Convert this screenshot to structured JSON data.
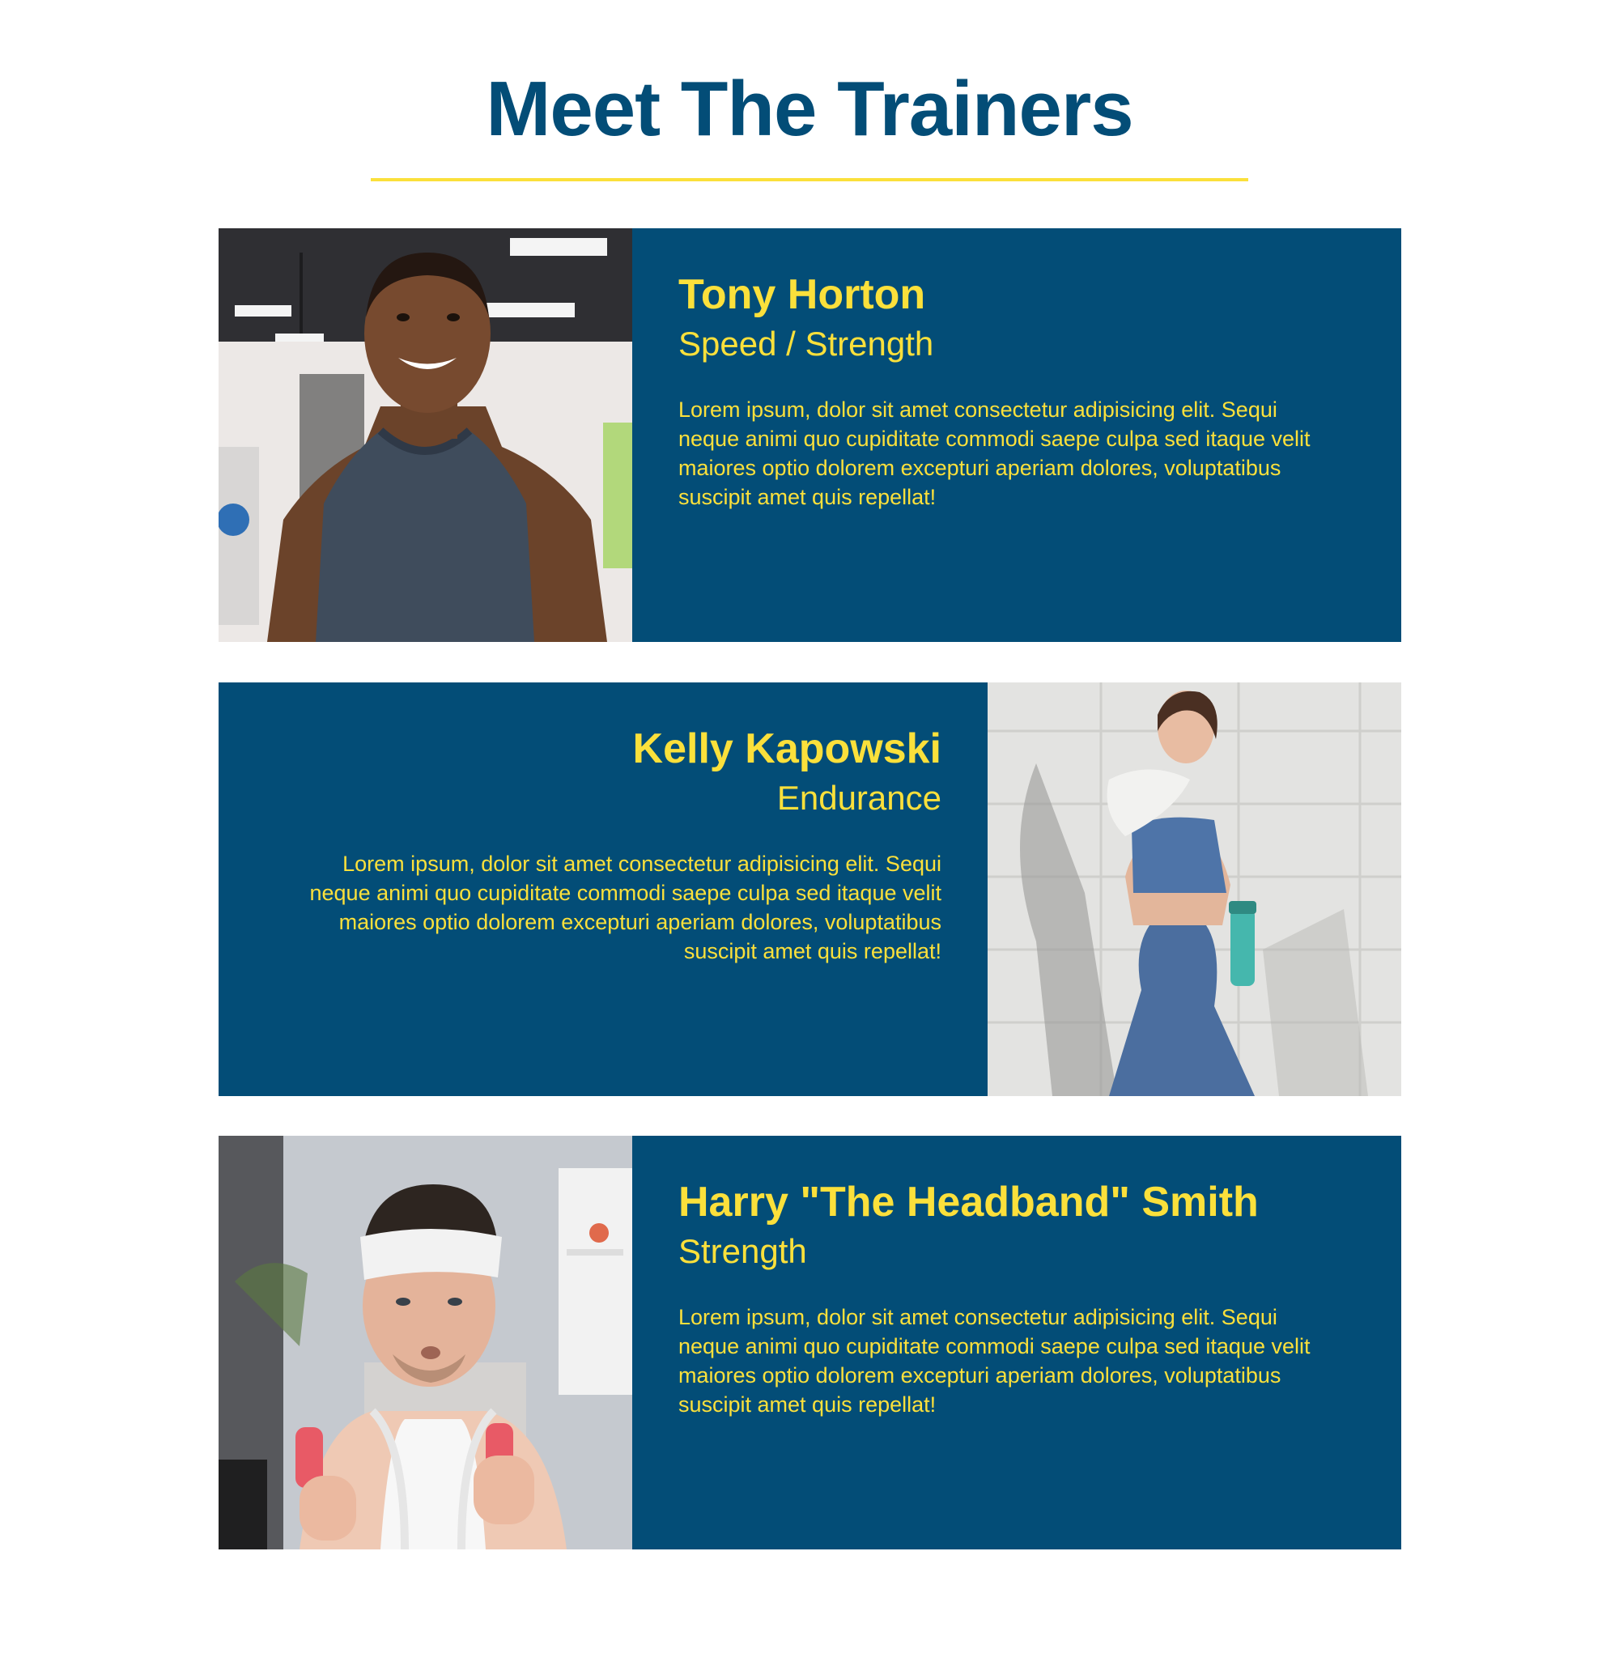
{
  "header": {
    "title": "Meet The Trainers"
  },
  "colors": {
    "brand_blue": "#034d77",
    "accent_yellow": "#fbe03b"
  },
  "trainers": [
    {
      "name": "Tony Horton",
      "specialty": "Speed / Strength",
      "bio": "Lorem ipsum, dolor sit amet consectetur adipisicing elit. Sequi neque animi quo cupiditate commodi saepe culpa sed itaque velit maiores optio dolorem excepturi aperiam dolores, voluptatibus suscipit amet quis repellat!",
      "photo_icon": "trainer-photo"
    },
    {
      "name": "Kelly Kapowski",
      "specialty": "Endurance",
      "bio": "Lorem ipsum, dolor sit amet consectetur adipisicing elit. Sequi neque animi quo cupiditate commodi saepe culpa sed itaque velit maiores optio dolorem excepturi aperiam dolores, voluptatibus suscipit amet quis repellat!",
      "photo_icon": "trainer-photo"
    },
    {
      "name": "Harry \"The Headband\" Smith",
      "specialty": "Strength",
      "bio": "Lorem ipsum, dolor sit amet consectetur adipisicing elit. Sequi neque animi quo cupiditate commodi saepe culpa sed itaque velit maiores optio dolorem excepturi aperiam dolores, voluptatibus suscipit amet quis repellat!",
      "photo_icon": "trainer-photo"
    }
  ]
}
